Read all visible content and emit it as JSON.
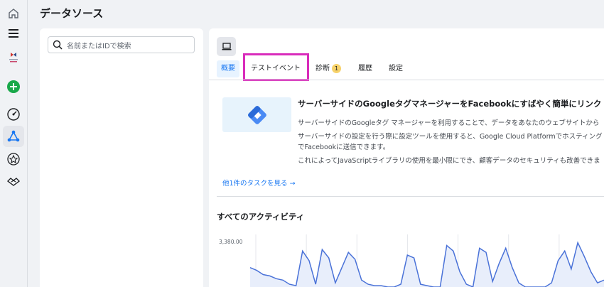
{
  "header": {
    "title": "データソース"
  },
  "left_panel": {
    "search_placeholder": "名前またはIDで検索"
  },
  "tabs": [
    {
      "label": "概要",
      "active": true
    },
    {
      "label": "テストイベント",
      "active": false,
      "highlighted": true
    },
    {
      "label": "診断",
      "badge": "1"
    },
    {
      "label": "履歴"
    },
    {
      "label": "設定"
    }
  ],
  "promo": {
    "title": "サーバーサイドのGoogleタグマネージャーをFacebookにすばやく簡単にリンク",
    "line1": "サーバーサイドのGoogleタグ マネージャーを利用することで、データをあなたのウェブサイトから",
    "line2": "サーバーサイドの設定を行う際に設定ツールを使用すると、Google Cloud Platformでホスティング",
    "line3": "でFacebookに送信できます。",
    "line4": "これによってJavaScriptライブラリの使用を最小限にでき、顧客データのセキュリティも改善できま",
    "more_link": "他1件のタスクを見る →"
  },
  "activity": {
    "title": "すべてのアクティビティ"
  },
  "chart_data": {
    "type": "area",
    "y_ticks": [
      "3,380.00"
    ],
    "values": [
      1500,
      1300,
      1000,
      900,
      700,
      600,
      300,
      200,
      2700,
      2000,
      300,
      2800,
      2200,
      400,
      1500,
      2600,
      2100,
      600,
      300,
      200,
      200,
      100,
      100,
      300,
      2400,
      2200,
      300,
      200,
      100,
      100,
      3100,
      2700,
      1200,
      300,
      100,
      2900,
      2600,
      500,
      1800,
      2900,
      1500,
      400,
      100,
      100,
      100,
      100,
      400,
      2000,
      2700,
      1400,
      3300,
      2300,
      1200,
      400,
      600
    ],
    "ylim": [
      0,
      3380
    ],
    "colors": {
      "line": "#4a72d8",
      "fill": "#e8eefb"
    }
  },
  "colors": {
    "accent": "#1877f2",
    "highlight": "#d92cbb",
    "badge": "#f7d26a"
  }
}
